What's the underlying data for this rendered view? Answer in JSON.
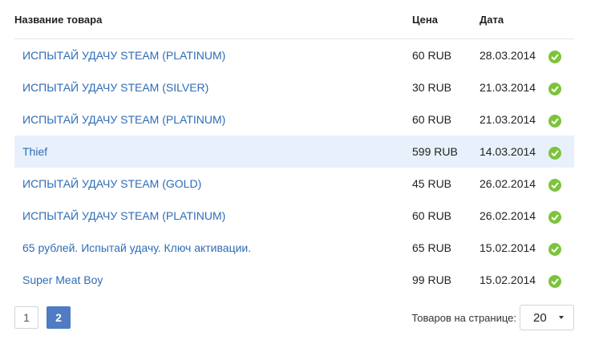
{
  "table": {
    "headers": {
      "name": "Название товара",
      "price": "Цена",
      "date": "Дата"
    },
    "rows": [
      {
        "name": "ИСПЫТАЙ УДАЧУ STEAM (PLATINUM)",
        "price": "60 RUB",
        "date": "28.03.2014",
        "status": "check-icon"
      },
      {
        "name": "ИСПЫТАЙ УДАЧУ STEAM (SILVER)",
        "price": "30 RUB",
        "date": "21.03.2014",
        "status": "check-icon"
      },
      {
        "name": "ИСПЫТАЙ УДАЧУ STEAM (PLATINUM)",
        "price": "60 RUB",
        "date": "21.03.2014",
        "status": "check-icon"
      },
      {
        "name": "Thief",
        "price": "599 RUB",
        "date": "14.03.2014",
        "status": "check-icon"
      },
      {
        "name": "ИСПЫТАЙ УДАЧУ STEAM (GOLD)",
        "price": "45 RUB",
        "date": "26.02.2014",
        "status": "check-icon"
      },
      {
        "name": "ИСПЫТАЙ УДАЧУ STEAM (PLATINUM)",
        "price": "60 RUB",
        "date": "26.02.2014",
        "status": "check-icon"
      },
      {
        "name": "65 рублей. Испытай удачу. Ключ активации.",
        "price": "65 RUB",
        "date": "15.02.2014",
        "status": "check-icon"
      },
      {
        "name": "Super Meat Boy",
        "price": "99 RUB",
        "date": "15.02.2014",
        "status": "check-icon"
      }
    ]
  },
  "pagination": {
    "pages": [
      "1",
      "2"
    ],
    "current": "2"
  },
  "per_page": {
    "label": "Товаров на странице:",
    "value": "20"
  },
  "colors": {
    "link": "#2f6db5",
    "highlight": "#e8f1fb",
    "check": "#7cc43a",
    "active_page": "#4f7cc2"
  }
}
